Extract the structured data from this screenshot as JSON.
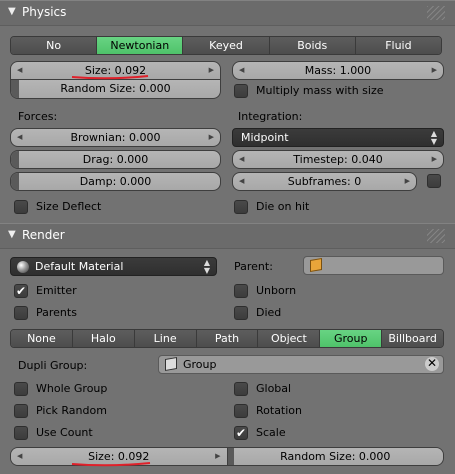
{
  "physics": {
    "title": "Physics",
    "tabs": [
      "No",
      "Newtonian",
      "Keyed",
      "Boids",
      "Fluid"
    ],
    "active_tab": "Newtonian",
    "size": "Size: 0.092",
    "random_size": "Random Size: 0.000",
    "mass": "Mass: 1.000",
    "multiply_mass": "Multiply mass with size",
    "forces_label": "Forces:",
    "integration_label": "Integration:",
    "brownian": "Brownian: 0.000",
    "drag": "Drag: 0.000",
    "damp": "Damp: 0.000",
    "integration_value": "Midpoint",
    "timestep": "Timestep: 0.040",
    "subframes": "Subframes: 0",
    "size_deflect": "Size Deflect",
    "die_on_hit": "Die on hit"
  },
  "render": {
    "title": "Render",
    "material": "Default Material",
    "parent_label": "Parent:",
    "emitter": "Emitter",
    "emitter_checked": true,
    "unborn": "Unborn",
    "parents": "Parents",
    "died": "Died",
    "tabs": [
      "None",
      "Halo",
      "Line",
      "Path",
      "Object",
      "Group",
      "Billboard"
    ],
    "active_tab": "Group",
    "dupli_group_label": "Dupli Group:",
    "dupli_group_value": "Group",
    "whole_group": "Whole Group",
    "global": "Global",
    "pick_random": "Pick Random",
    "rotation": "Rotation",
    "use_count": "Use Count",
    "scale": "Scale",
    "scale_checked": true,
    "size": "Size: 0.092",
    "random_size": "Random Size: 0.000"
  },
  "colors": {
    "background": "#727272",
    "active_green": "#5acb76",
    "annotation_red": "#e0202a"
  }
}
